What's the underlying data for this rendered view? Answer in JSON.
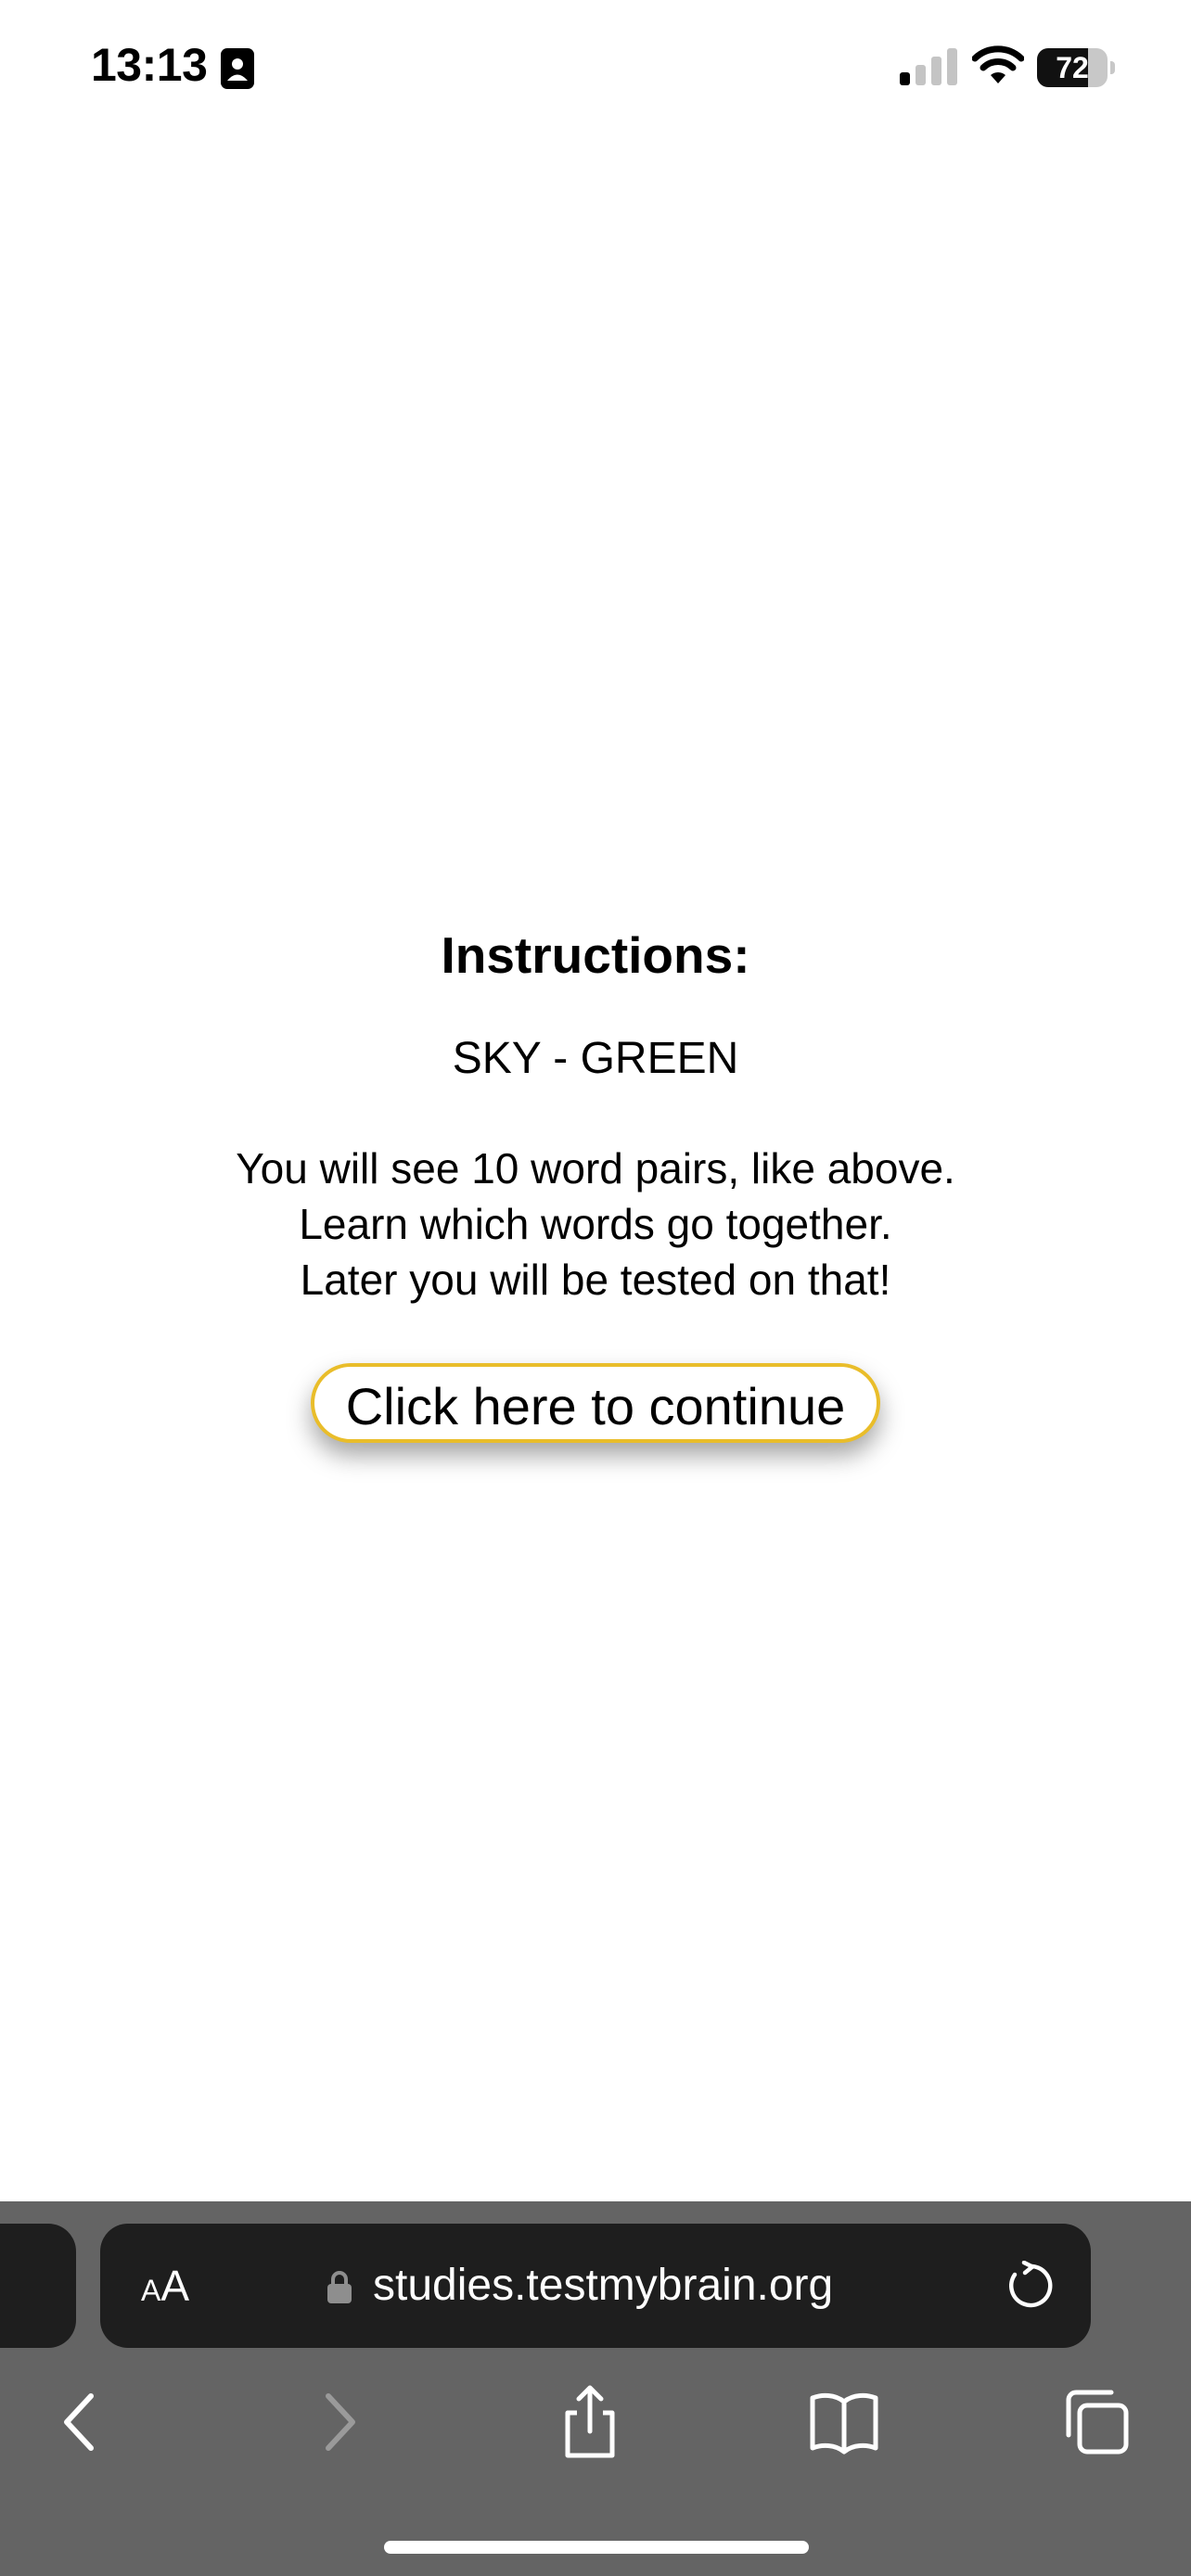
{
  "status_bar": {
    "time": "13:13",
    "battery_level": "72",
    "battery_fraction": 0.72,
    "icons": [
      "contact-card-icon",
      "cellular-signal-icon",
      "wifi-icon",
      "battery-icon"
    ]
  },
  "instructions": {
    "heading": "Instructions:",
    "example_pair": "SKY - GREEN",
    "lines": [
      "You will see 10 word pairs, like above.",
      "Learn which words go together.",
      "Later you will be tested on that!"
    ],
    "continue_label": "Click here to continue"
  },
  "browser": {
    "text_size_label_small": "A",
    "text_size_label_big": "A",
    "url": "studies.testmybrain.org",
    "toolbar_icons": [
      "back-icon",
      "forward-icon",
      "share-icon",
      "bookmarks-icon",
      "tabs-icon",
      "reload-icon",
      "lock-icon"
    ]
  },
  "colors": {
    "button_border": "#e9bd2a",
    "toolbar_background": "#646464",
    "address_bar_background": "#1e1e1e"
  }
}
